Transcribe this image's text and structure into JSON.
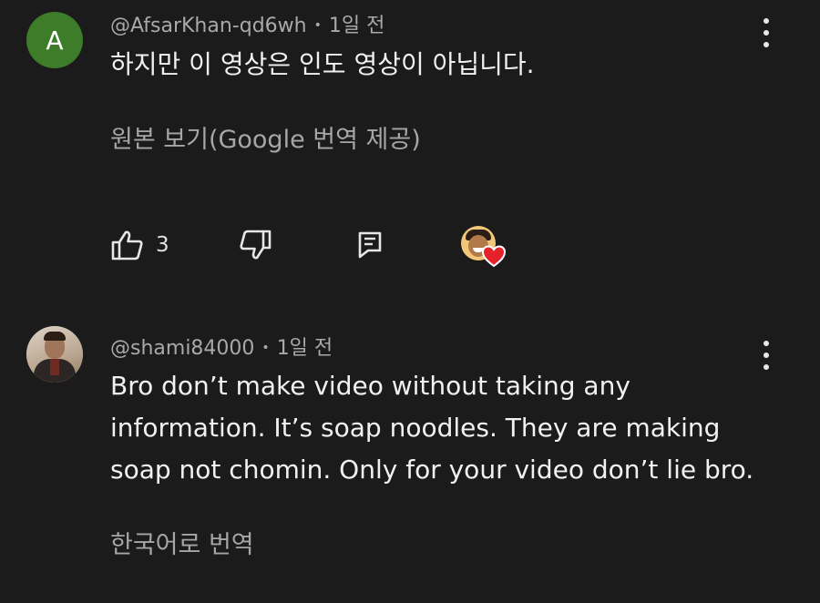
{
  "comments": [
    {
      "avatar_letter": "A",
      "avatar_color": "#3d7d2a",
      "author": "@AfsarKhan-qd6wh",
      "time": "1일 전",
      "text_lines": [
        "하지만 이 영상은 인도 영상이 아닙니다."
      ],
      "translate_link": "원본 보기(Google 번역 제공)",
      "like_count": "3",
      "icons": [
        "like-icon",
        "dislike-icon",
        "reply-icon",
        "creator-heart-icon",
        "more-vert-icon"
      ]
    },
    {
      "avatar": "profile-photo",
      "author": "@shami84000",
      "time": "1일 전",
      "text_lines": [
        "Bro don’t make video without taking any",
        "information. It’s soap noodles. They are making",
        "soap not chomin. Only for your video don’t lie bro."
      ],
      "translate_link": "한국어로 번역",
      "icons": [
        "more-vert-icon"
      ]
    }
  ],
  "meta_separator": "•",
  "colors": {
    "background": "#1b1b1c",
    "meta_text": "#a9a9a9",
    "body_text": "#f1f1f1",
    "heart": "#e5212a"
  }
}
